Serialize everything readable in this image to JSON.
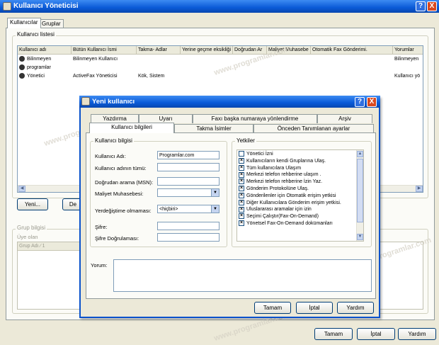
{
  "window": {
    "title": "Kullanıcı Yöneticisi",
    "help": "?",
    "close": "X"
  },
  "tabs": [
    "Kullanıcılar",
    "Gruplar"
  ],
  "user_list": {
    "label": "Kullanıcı listesi",
    "columns": [
      "Kullanıcı adı",
      "Bütün Kullanıcı İsmi",
      "Takma- Adlar",
      "Yerine geçme eksikliği",
      "Doğrudan Ar",
      "Maliyet Muhasebe",
      "Otomatik Fax Gönderimi.",
      "Yorumlar"
    ],
    "rows": [
      {
        "name": "Bilinmeyen",
        "full": "Bilinmeyen Kullanıcı",
        "alias": "",
        "comment": "Bilinmeyen"
      },
      {
        "name": "programlar",
        "full": "",
        "alias": "",
        "comment": ""
      },
      {
        "name": "Yönetici",
        "full": "ActiveFax Yöneticisi",
        "alias": "Kök, Sistem",
        "comment": "Kullanıcı yö"
      }
    ]
  },
  "main_buttons": {
    "new": "Yeni...",
    "edit": "De",
    "ok": "Tamam",
    "cancel": "İptal",
    "help": "Yardım"
  },
  "group_info": {
    "label": "Grup bilgisi",
    "members": "Üye olan",
    "col": "Grup Adı ∕ 1"
  },
  "dialog": {
    "title": "Yeni kullanıcı",
    "help": "?",
    "close": "X",
    "tabs_row1": [
      "Yazdırma",
      "Uyarı",
      "Faxı başka numaraya yönlendirme",
      "Arşiv"
    ],
    "tabs_row2": [
      "Kullanıcı bilgileri",
      "Takma İsimler",
      "Önceden Tanımlanan ayarlar"
    ],
    "user_info_label": "Kullanıcı bilgisi",
    "fields": {
      "username_label": "Kullanıcı Adı:",
      "username_value": "Programlar.com",
      "fullname_label": "Kullanıcı adının tümü:",
      "direct_label": "Doğrudan arama (MSN):",
      "cost_label": "Maliyet Muhasebesi:",
      "replace_label": "Yerdeğiştime olmaması:",
      "replace_value": "<hiçbiri>",
      "password_label": "Şifre:",
      "confirm_label": "Şifre Doğrulaması:"
    },
    "perms_label": "Yetkiler",
    "permissions": [
      {
        "label": "Yönetici İzni",
        "checked": false
      },
      {
        "label": "Kullanıcıların kendi Gruplarına Ulaş.",
        "checked": true
      },
      {
        "label": "Tüm kullanıcılara Ulaşım",
        "checked": true
      },
      {
        "label": "Merkezi telefon rehberine ulaşım .",
        "checked": true
      },
      {
        "label": "Merkezi telefon rehberine İzin Yaz.",
        "checked": true
      },
      {
        "label": "Gönderim Protokolüne Ulaş.",
        "checked": true
      },
      {
        "label": "Gönderilenler için Otomatik erişim yetkisi",
        "checked": true
      },
      {
        "label": "Diğer Kullanıcılara Gönderim erişim yetkisi.",
        "checked": true
      },
      {
        "label": "Uluslararası aramalar için izin",
        "checked": true
      },
      {
        "label": "Seçimi Çalıştır(Fax-On-Demand)",
        "checked": true
      },
      {
        "label": "Yönetsel Fax-On-Demand dokümanları",
        "checked": true
      }
    ],
    "comment_label": "Yorum:",
    "buttons": {
      "ok": "Tamam",
      "cancel": "İptal",
      "help": "Yardım"
    }
  },
  "watermark": "www.programlar.com"
}
